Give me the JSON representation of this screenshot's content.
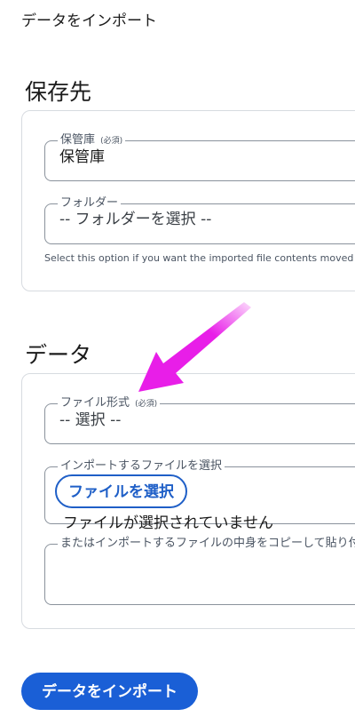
{
  "page": {
    "title": "データをインポート"
  },
  "destination": {
    "heading": "保存先",
    "vault": {
      "label": "保管庫",
      "required": "(必須)",
      "value": "保管庫"
    },
    "folder": {
      "label": "フォルダー",
      "value": "-- フォルダーを選択 --"
    },
    "hint": "Select this option if you want the imported file contents moved"
  },
  "data": {
    "heading": "データ",
    "format": {
      "label": "ファイル形式",
      "required": "(必須)",
      "value": "-- 選択 --"
    },
    "file": {
      "label": "インポートするファイルを選択",
      "button": "ファイルを選択",
      "status": "ファイルが選択されていません"
    },
    "paste": {
      "label": "またはインポートするファイルの中身をコピーして貼り付け"
    }
  },
  "actions": {
    "import_button": "データをインポート"
  },
  "annotation": {
    "icon": "arrow-icon",
    "color": "#e81ee8"
  }
}
